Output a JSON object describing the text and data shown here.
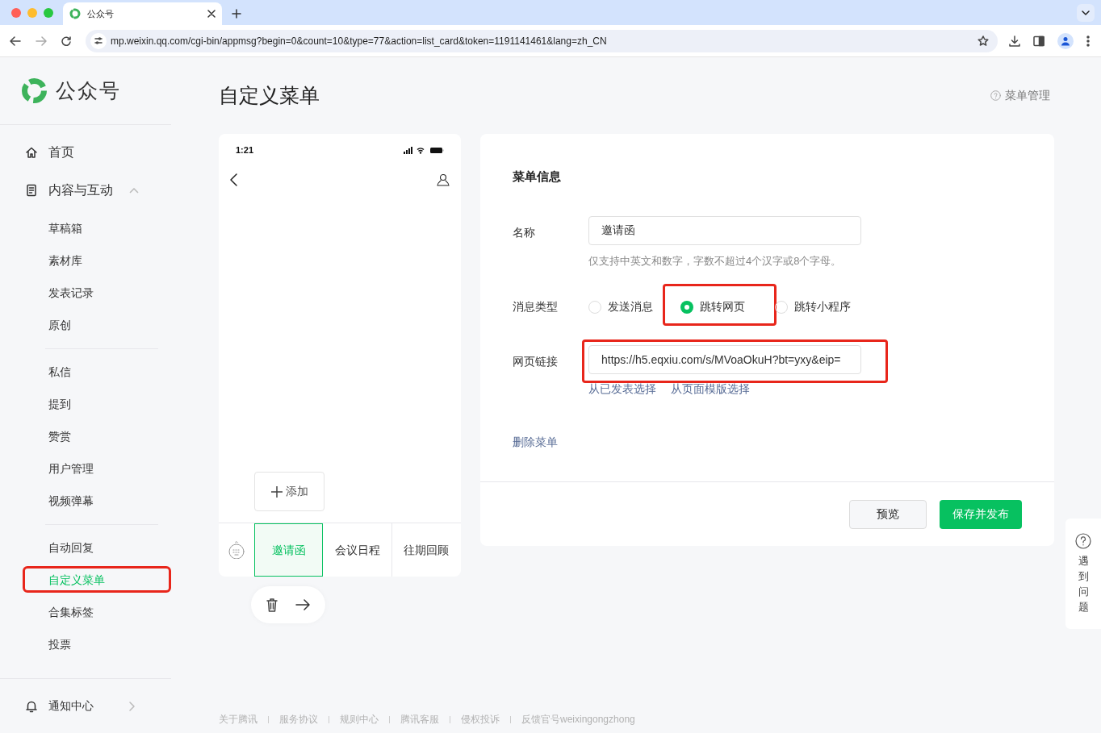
{
  "browser": {
    "tab_title": "公众号",
    "url": "mp.weixin.qq.com/cgi-bin/appmsg?begin=0&count=10&type=77&action=list_card&token=1191141461&lang=zh_CN"
  },
  "sidebar": {
    "logo_text": "公众号",
    "nav": [
      {
        "label": "首页",
        "selected": false
      },
      {
        "label": "内容与互动",
        "expanded": true,
        "groups": [
          {
            "items": [
              {
                "label": "草稿箱",
                "selected": false,
                "highlighted": false
              },
              {
                "label": "素材库",
                "selected": false,
                "highlighted": false
              },
              {
                "label": "发表记录",
                "selected": false,
                "highlighted": false
              },
              {
                "label": "原创",
                "selected": false,
                "highlighted": false
              }
            ]
          },
          {
            "items": [
              {
                "label": "私信",
                "selected": false,
                "highlighted": false
              },
              {
                "label": "提到",
                "selected": false,
                "highlighted": false
              },
              {
                "label": "赞赏",
                "selected": false,
                "highlighted": false
              },
              {
                "label": "用户管理",
                "selected": false,
                "highlighted": false
              },
              {
                "label": "视频弹幕",
                "selected": false,
                "highlighted": false
              }
            ]
          },
          {
            "items": [
              {
                "label": "自动回复",
                "selected": false,
                "highlighted": false
              },
              {
                "label": "自定义菜单",
                "selected": true,
                "highlighted": true
              },
              {
                "label": "合集标签",
                "selected": false,
                "highlighted": false
              },
              {
                "label": "投票",
                "selected": false,
                "highlighted": false
              }
            ]
          }
        ]
      }
    ],
    "bottom": {
      "label": "通知中心"
    }
  },
  "page_title": "自定义菜单",
  "help_link": "菜单管理",
  "phone": {
    "time": "1:21",
    "add_button": "添加",
    "menu_items": [
      {
        "label": "邀请函",
        "selected": true
      },
      {
        "label": "会议日程",
        "selected": false
      },
      {
        "label": "往期回顾",
        "selected": false
      }
    ]
  },
  "form": {
    "heading": "菜单信息",
    "name_label": "名称",
    "name_value": "邀请函",
    "name_hint": "仅支持中英文和数字，字数不超过4个汉字或8个字母。",
    "type_label": "消息类型",
    "options": [
      {
        "label": "发送消息",
        "selected": false,
        "highlighted": false
      },
      {
        "label": "跳转网页",
        "selected": true,
        "highlighted": true
      },
      {
        "label": "跳转小程序",
        "selected": false,
        "highlighted": false
      }
    ],
    "url_label": "网页链接",
    "url_value": "https://h5.eqxiu.com/s/MVoaOkuH?bt=yxy&eip=",
    "url_highlighted": true,
    "url_links": [
      "从已发表选择",
      "从页面模版选择"
    ],
    "delete_link": "删除菜单",
    "buttons": [
      {
        "label": "预览",
        "kind": "secondary"
      },
      {
        "label": "保存并发布",
        "kind": "primary"
      }
    ]
  },
  "footer_links": [
    "关于腾讯",
    "服务协议",
    "规则中心",
    "腾讯客服",
    "侵权投诉",
    "反馈官号weixingongzhong"
  ],
  "help_float": "遇到问题"
}
